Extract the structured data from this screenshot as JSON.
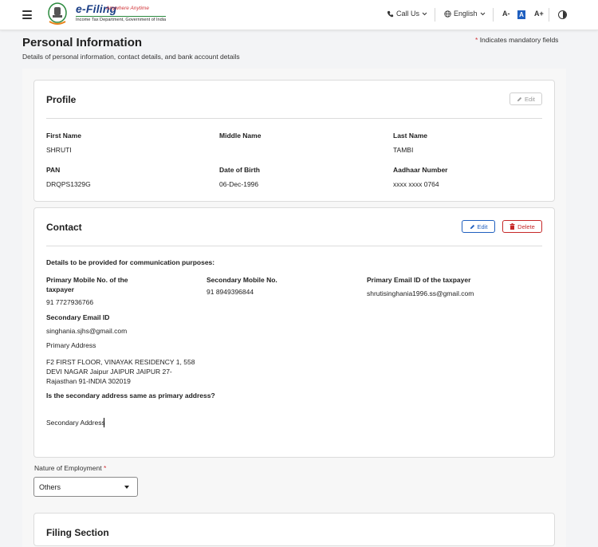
{
  "header": {
    "logo_title": "e-Filing",
    "logo_tagline": "Anywhere Anytime",
    "logo_subtitle": "Income Tax Department, Government of India",
    "call_us": "Call Us",
    "language": "English",
    "font_decrease": "A-",
    "font_default": "A",
    "font_increase": "A+"
  },
  "page": {
    "title": "Personal Information",
    "subtitle": "Details of personal information, contact details, and bank account details",
    "mandatory_star": "*",
    "mandatory_note": "Indicates mandatory fields"
  },
  "profile": {
    "title": "Profile",
    "edit_label": "Edit",
    "fields": {
      "first_name_label": "First Name",
      "first_name": "SHRUTI",
      "middle_name_label": "Middle Name",
      "middle_name": "",
      "last_name_label": "Last Name",
      "last_name": "TAMBI",
      "pan_label": "PAN",
      "pan": "DRQPS1329G",
      "dob_label": "Date of Birth",
      "dob": "06-Dec-1996",
      "aadhaar_label": "Aadhaar Number",
      "aadhaar": "xxxx xxxx 0764"
    }
  },
  "contact": {
    "title": "Contact",
    "edit_label": "Edit",
    "delete_label": "Delete",
    "comm_note": "Details to be provided for communication purposes:",
    "primary_mobile_label_1": "Primary Mobile No. of the",
    "primary_mobile_label_2": "taxpayer",
    "primary_mobile": "91  7727936766",
    "secondary_mobile_label": "Secondary Mobile No.",
    "secondary_mobile": "91  8949396844",
    "primary_email_label": "Primary Email ID of the taxpayer",
    "primary_email": "shrutisinghania1996.ss@gmail.com",
    "secondary_email_label": "Secondary Email ID",
    "secondary_email": "singhania.sjhs@gmail.com",
    "primary_address_label": "Primary Address",
    "primary_address_line1": "F2 FIRST FLOOR, VINAYAK RESIDENCY 1, 558",
    "primary_address_line2": "DEVI NAGAR  Jaipur  JAIPUR  JAIPUR  27-",
    "primary_address_line3": "Rajasthan  91-INDIA  302019",
    "same_address_question": "Is the secondary address same as primary address?",
    "secondary_address_label": "Secondary Address"
  },
  "employment": {
    "label": "Nature of Employment",
    "required_star": "*",
    "selected": "Others"
  },
  "filing": {
    "title": "Filing Section"
  }
}
